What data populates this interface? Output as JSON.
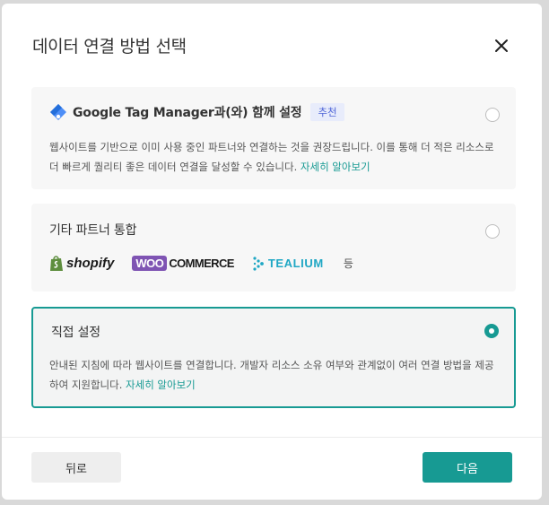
{
  "modal": {
    "title": "데이터 연결 방법 선택",
    "close_icon": "close-icon"
  },
  "options": [
    {
      "title": "Google Tag Manager과(와) 함께 설정",
      "badge": "추천",
      "description": "웹사이트를 기반으로 이미 사용 중인 파트너와 연결하는 것을 권장드립니다. 이를 통해 더 적은 리소스로 더 빠르게 퀄리티 좋은 데이터 연결을 달성할 수 있습니다.",
      "link": "자세히 알아보기",
      "selected": false
    },
    {
      "title": "기타 파트너 통합",
      "partners": [
        "shopify",
        "WOO",
        "COMMERCE",
        "TEALIUM"
      ],
      "etc": "등",
      "selected": false
    },
    {
      "title": "직접 설정",
      "description": "안내된 지침에 따라 웹사이트를 연결합니다. 개발자 리소스 소유 여부와 관계없이 여러 연결 방법을 제공하여 지원합니다.",
      "link": "자세히 알아보기",
      "selected": true
    }
  ],
  "footer": {
    "back_label": "뒤로",
    "next_label": "다음"
  },
  "colors": {
    "accent": "#179a93",
    "badge_bg": "#e8ecfb",
    "badge_text": "#5167d8"
  }
}
